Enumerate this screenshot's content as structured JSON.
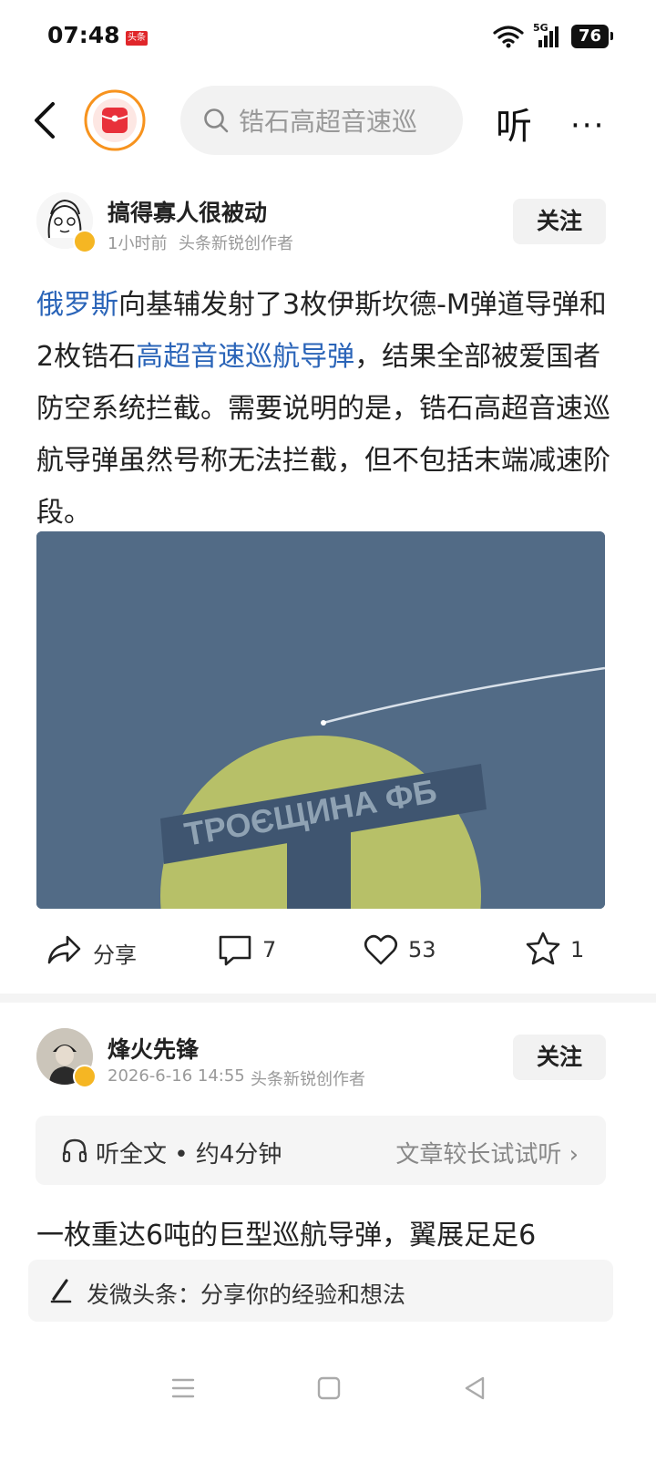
{
  "status_bar": {
    "time": "07:48",
    "app_badge": "头条",
    "network": "5G",
    "battery": "76"
  },
  "header": {
    "search_placeholder": "锆石高超音速巡",
    "listen_label": "听",
    "more_label": "···"
  },
  "post1": {
    "author": "搞得寡人很被动",
    "time": "1小时前",
    "role": "头条新锐创作者",
    "follow_label": "关注",
    "text_link1": "俄罗斯",
    "text_part1": "向基辅发射了3枚伊斯坎德-M弹道导弹和2枚锆石",
    "text_link2": "高超音速巡航导弹",
    "text_part2": "，结果全部被爱国者防空系统拦截。需要说明的是，锆石高超音速巡航导弹虽然号称无法拦截，但不包括末端减速阶段。",
    "image_text": "ТРОЄЩИНА ФБ",
    "actions": {
      "share_label": "分享",
      "comments": "7",
      "likes": "53",
      "favorites": "1"
    }
  },
  "post2": {
    "author": "烽火先锋",
    "time": "2026-6-16 14:55",
    "role": "头条新锐创作者",
    "follow_label": "关注",
    "listen_full": "听全文 • 约4分钟",
    "listen_hint": "文章较长试试听",
    "preview_text": "一枚重达6吨的巨型巡航导弹，翼展足足6"
  },
  "compose": {
    "placeholder": "发微头条：分享你的经验和想法"
  },
  "colors": {
    "link": "#2a64b8",
    "accent_orange": "#f7931e",
    "logo_red": "#e8303a",
    "badge_gold": "#f5b623"
  }
}
